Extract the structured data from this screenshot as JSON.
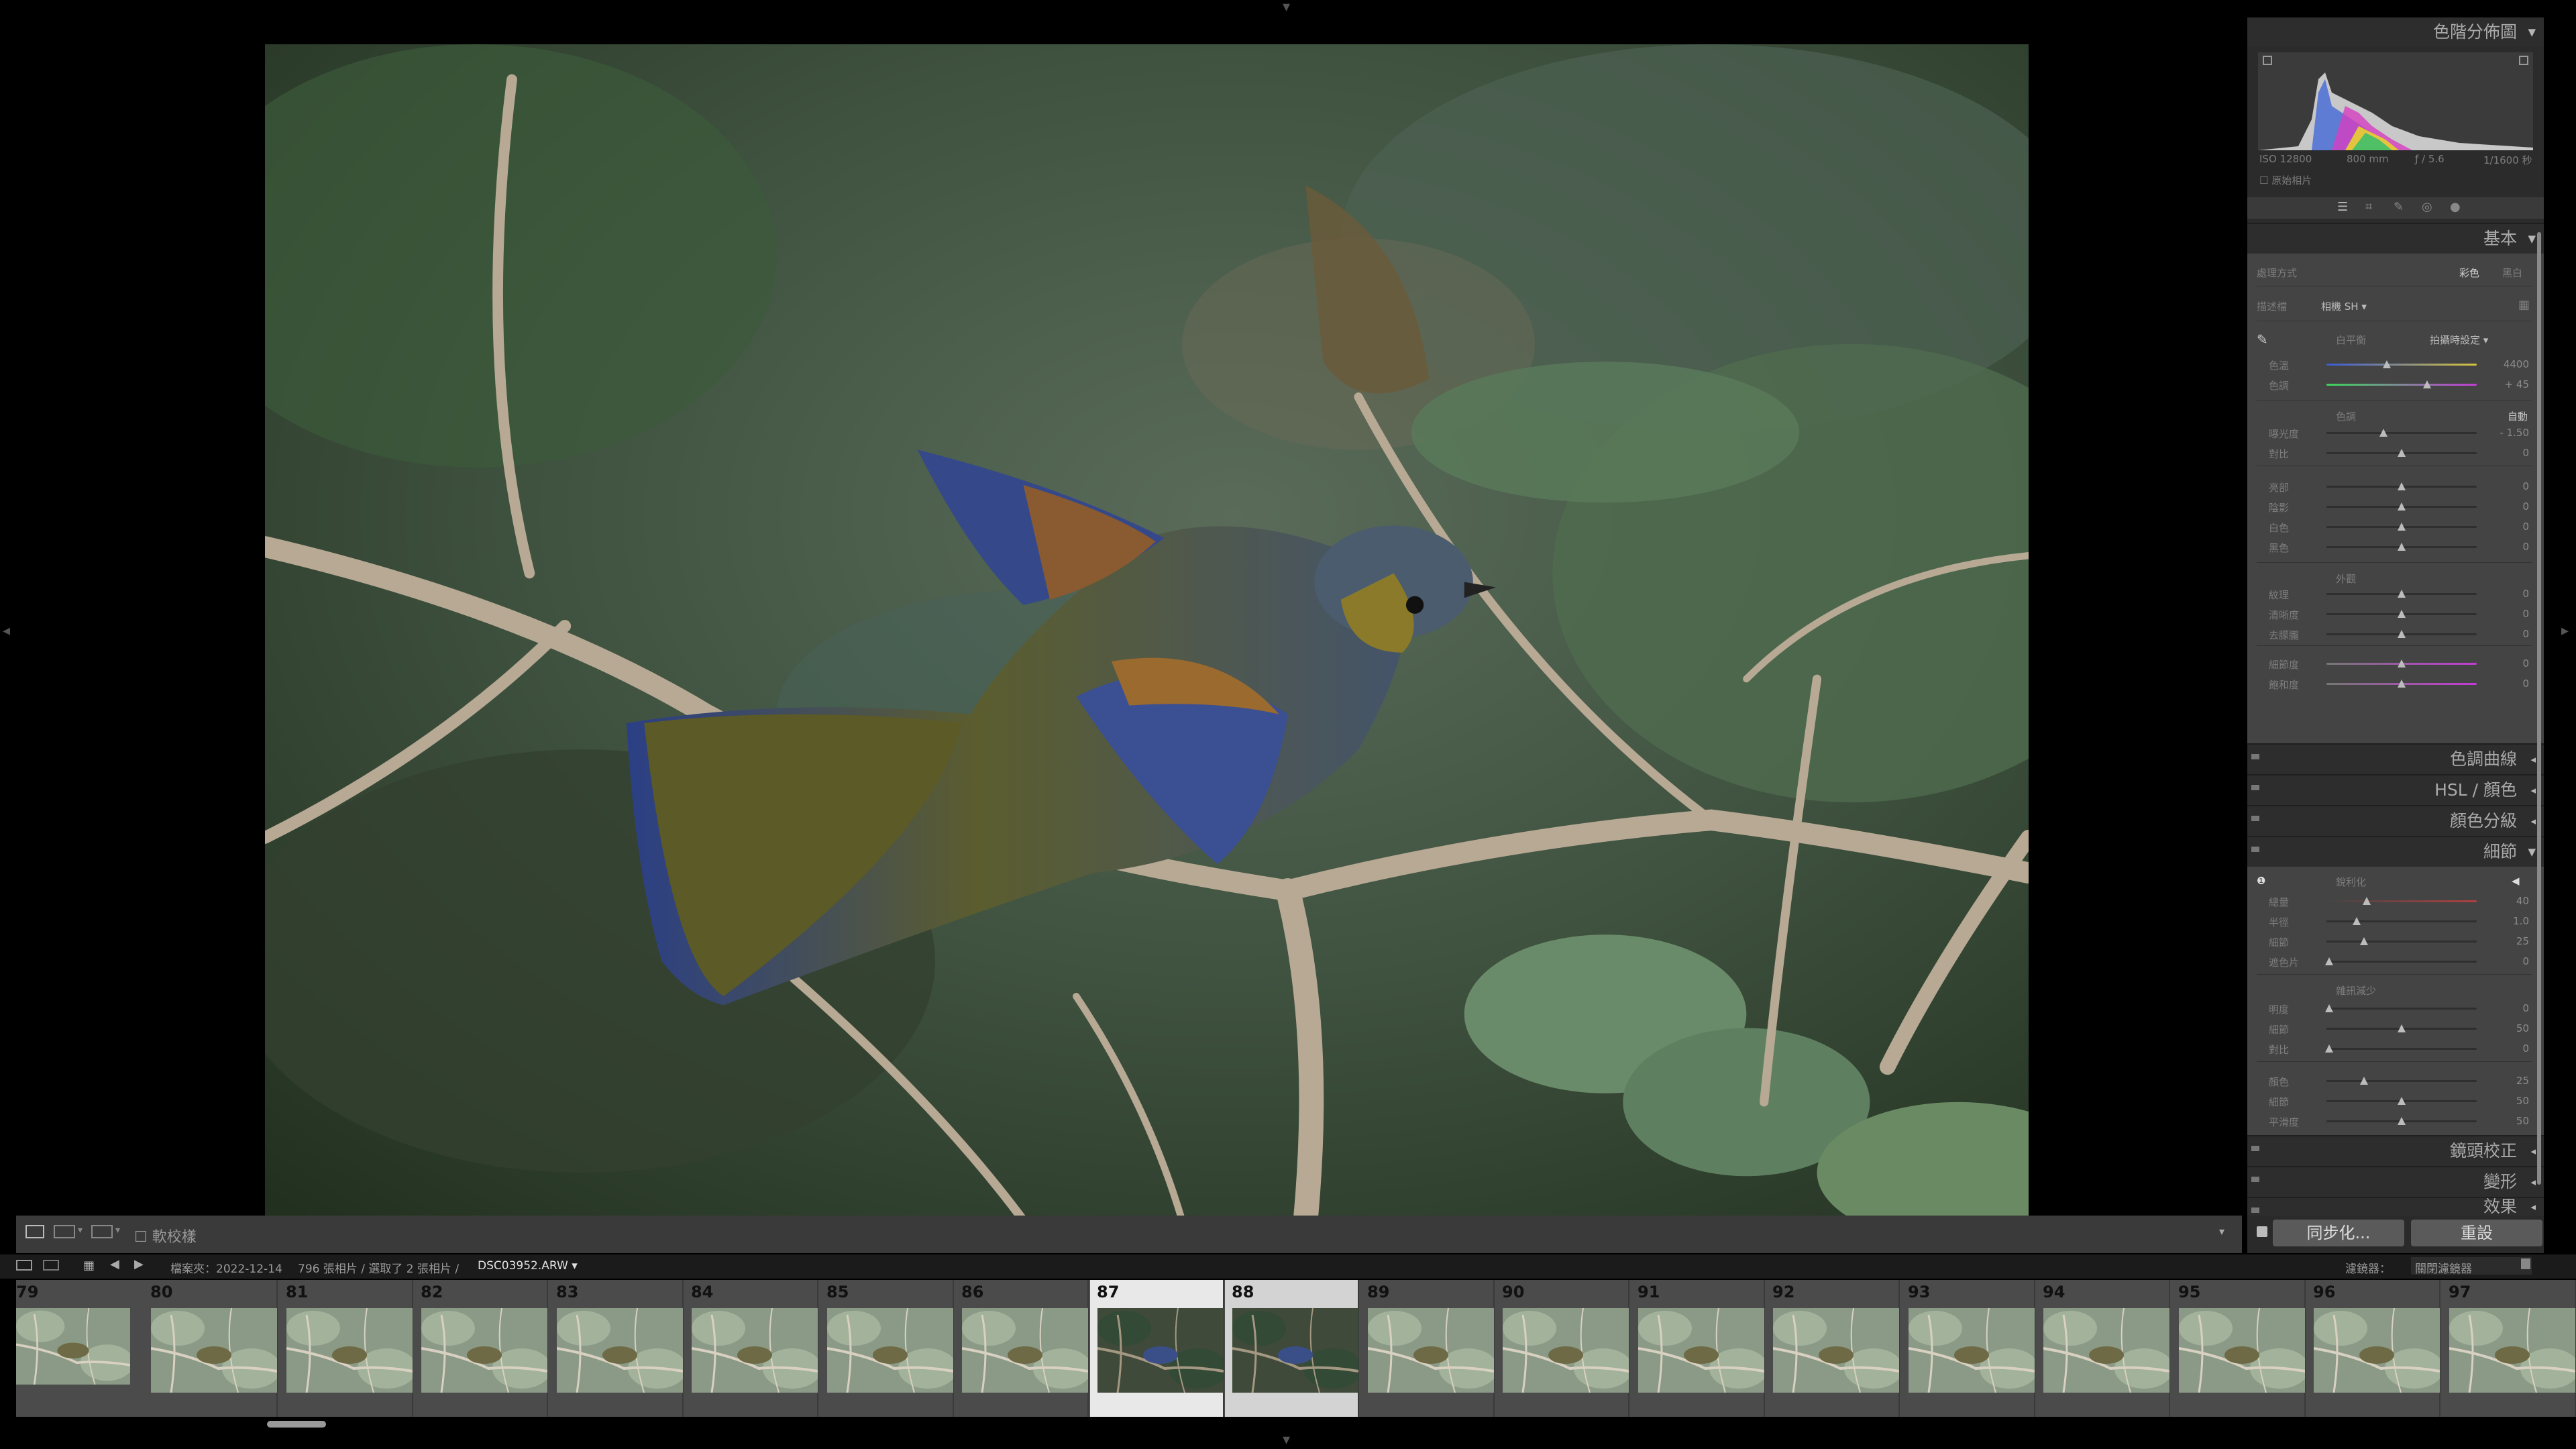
{
  "right_panel": {
    "histogram": {
      "title": "色階分佈圖",
      "iso": "ISO 12800",
      "focal": "800 mm",
      "aperture": "ƒ / 5.6",
      "shutter": "1/1600 秒",
      "original_photo": "原始相片"
    },
    "basic": {
      "title": "基本",
      "treatment_label": "處理方式",
      "treatment_color": "彩色",
      "treatment_bw": "黑白",
      "profile_label": "描述檔",
      "profile_value": "相機 SH",
      "wb_label": "白平衡",
      "wb_value": "拍攝時設定",
      "temp_label": "色溫",
      "temp_value": "4400",
      "tint_label": "色調",
      "tint_value": "+ 45",
      "tone_label": "色調",
      "auto_label": "自動",
      "exposure_label": "曝光度",
      "exposure_value": "- 1.50",
      "contrast_label": "對比",
      "contrast_value": "0",
      "highlights_label": "亮部",
      "highlights_value": "0",
      "shadows_label": "陰影",
      "shadows_value": "0",
      "whites_label": "白色",
      "whites_value": "0",
      "blacks_label": "黑色",
      "blacks_value": "0",
      "presence_label": "外觀",
      "texture_label": "紋理",
      "texture_value": "0",
      "clarity_label": "清晰度",
      "clarity_value": "0",
      "dehaze_label": "去朦朧",
      "dehaze_value": "0",
      "vibrance_label": "細節度",
      "vibrance_value": "0",
      "saturation_label": "飽和度",
      "saturation_value": "0"
    },
    "sections": {
      "tone_curve": "色調曲線",
      "hsl": "HSL / 顏色",
      "color_grading": "顏色分級",
      "detail": "細節"
    },
    "detail": {
      "sharpen_label": "銳利化",
      "amount_label": "總量",
      "amount_value": "40",
      "radius_label": "半徑",
      "radius_value": "1.0",
      "detail_label": "細節",
      "detail_value": "25",
      "masking_label": "遮色片",
      "masking_value": "0",
      "nr_label": "雜訊減少",
      "lum_label": "明度",
      "lum_value": "0",
      "lum_detail_label": "細節",
      "lum_detail_value": "50",
      "lum_contrast_label": "對比",
      "lum_contrast_value": "0",
      "color_label": "顏色",
      "color_value": "25",
      "color_detail_label": "細節",
      "color_detail_value": "50",
      "smooth_label": "平滑度",
      "smooth_value": "50"
    },
    "lens_corrections": "鏡頭校正",
    "transform": "變形",
    "effects": "效果",
    "sync_button": "同步化...",
    "reset_button": "重設"
  },
  "toolbar": {
    "softproof": "軟校樣"
  },
  "filmbar": {
    "folder": "檔案夾：2022-12-14",
    "count": "796 張相片 / 選取了 2 張相片 /",
    "filename": "DSC03952.ARW",
    "filter_label": "濾鏡器：",
    "filter_value": "關閉濾鏡器"
  },
  "filmstrip": {
    "first_number": "79",
    "numbers": [
      "80",
      "81",
      "82",
      "83",
      "84",
      "85",
      "86",
      "87",
      "88",
      "89",
      "90",
      "91",
      "92",
      "93",
      "94",
      "95",
      "96",
      "97"
    ],
    "selected": [
      "87",
      "88"
    ]
  },
  "colors": {
    "panel_bg": "#1f1f1f",
    "section_header": "#2d2d2d",
    "section_body": "#444444",
    "filmstrip_bg": "#4b4b4b",
    "selected_cell": "#e8e8e8"
  }
}
